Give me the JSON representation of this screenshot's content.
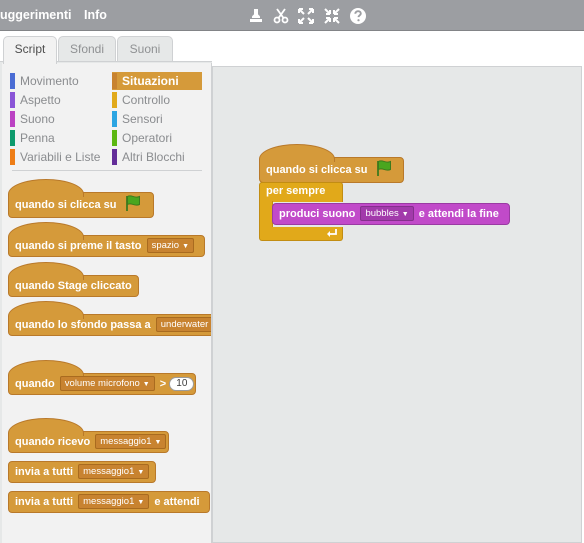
{
  "menubar": {
    "suggestions_label": "uggerimenti",
    "info_label": "Info"
  },
  "tabs": {
    "script": "Script",
    "backdrops": "Sfondi",
    "sounds": "Suoni"
  },
  "palette": {
    "categories_left": [
      {
        "label": "Movimento",
        "color": "#4a6cd4"
      },
      {
        "label": "Aspetto",
        "color": "#8a55d7"
      },
      {
        "label": "Suono",
        "color": "#bb42c3"
      },
      {
        "label": "Penna",
        "color": "#0e9a6c"
      },
      {
        "label": "Variabili e Liste",
        "color": "#ee7d16"
      }
    ],
    "categories_right": [
      {
        "label": "Situazioni",
        "color": "#c88330",
        "selected": true
      },
      {
        "label": "Controllo",
        "color": "#e1a91a"
      },
      {
        "label": "Sensori",
        "color": "#2ca5e2"
      },
      {
        "label": "Operatori",
        "color": "#5cb712"
      },
      {
        "label": "Altri Blocchi",
        "color": "#632d99"
      }
    ],
    "blocks": {
      "when_flag": "quando si clicca su",
      "when_key_prefix": "quando si preme il tasto",
      "when_key_value": "spazio",
      "when_stage": "quando Stage cliccato",
      "when_backdrop_prefix": "quando lo sfondo passa a",
      "when_backdrop_value": "underwater",
      "when_sensor_prefix": "quando",
      "when_sensor_value": "volume microfono",
      "when_sensor_op": ">",
      "when_sensor_number": "10",
      "when_receive_prefix": "quando ricevo",
      "when_receive_value": "messaggio1",
      "broadcast_prefix": "invia a tutti",
      "broadcast_value": "messaggio1",
      "broadcast_wait_prefix": "invia a tutti",
      "broadcast_wait_value": "messaggio1",
      "broadcast_wait_suffix": "e attendi"
    }
  },
  "script": {
    "hat": "quando si clicca su",
    "forever": "per sempre",
    "sound_prefix": "produci suono",
    "sound_value": "bubbles",
    "sound_suffix": "e attendi la fine"
  }
}
